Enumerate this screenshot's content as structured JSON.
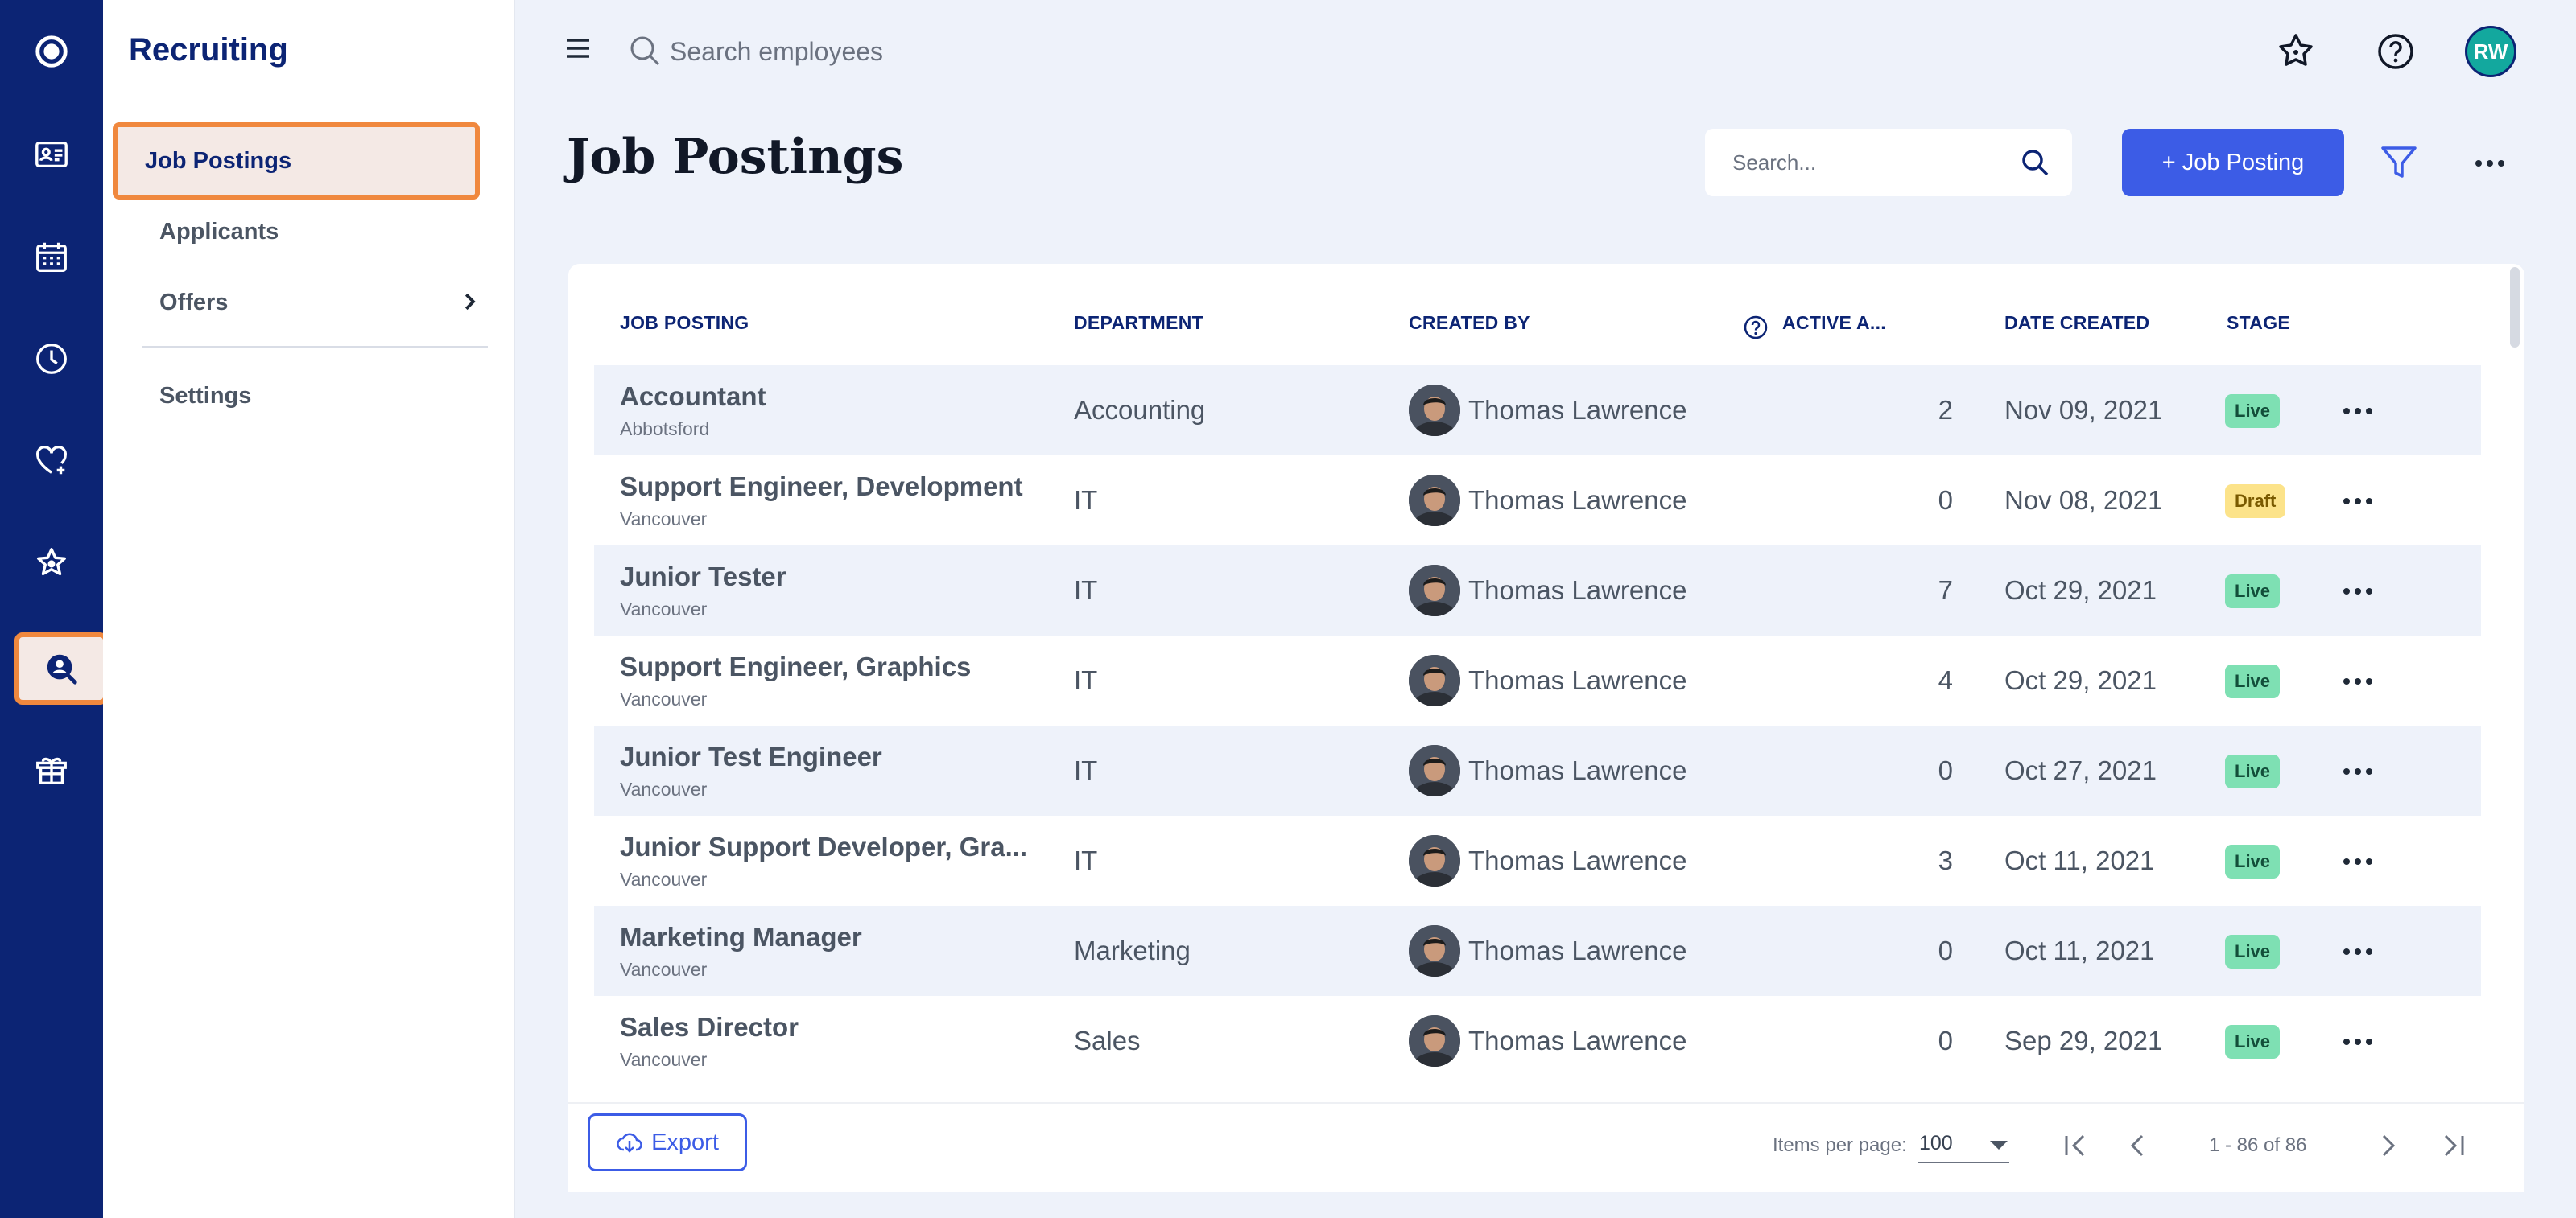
{
  "rail": {
    "items": [
      {
        "icon": "app-logo-icon",
        "active": false
      },
      {
        "icon": "id-card-icon",
        "active": false
      },
      {
        "icon": "calendar-icon",
        "active": false
      },
      {
        "icon": "clock-icon",
        "active": false
      },
      {
        "icon": "heart-plus-icon",
        "active": false
      },
      {
        "icon": "star-icon",
        "active": false
      },
      {
        "icon": "recruiting-search-icon",
        "active": true
      },
      {
        "icon": "gift-box-icon",
        "active": false
      }
    ]
  },
  "subnav": {
    "title": "Recruiting",
    "items": [
      {
        "label": "Job Postings",
        "active": true
      },
      {
        "label": "Applicants",
        "active": false
      },
      {
        "label": "Offers",
        "active": false,
        "has_submenu": true
      },
      {
        "label": "Settings",
        "active": false
      }
    ]
  },
  "topbar": {
    "search_placeholder": "Search employees",
    "avatar_initials": "RW",
    "avatar_color": "#13a89e"
  },
  "page": {
    "title": "Job Postings",
    "search_placeholder": "Search...",
    "add_label": "+ Job Posting",
    "accent_color": "#3c5ce6"
  },
  "table": {
    "columns": [
      "JOB POSTING",
      "DEPARTMENT",
      "CREATED BY",
      "ACTIVE A...",
      "DATE CREATED",
      "STAGE"
    ],
    "rows": [
      {
        "title": "Accountant",
        "location": "Abbotsford",
        "department": "Accounting",
        "created_by": "Thomas Lawrence",
        "active": "2",
        "date": "Nov 09, 2021",
        "stage": "Live"
      },
      {
        "title": "Support Engineer, Development",
        "location": "Vancouver",
        "department": "IT",
        "created_by": "Thomas Lawrence",
        "active": "0",
        "date": "Nov 08, 2021",
        "stage": "Draft"
      },
      {
        "title": "Junior Tester",
        "location": "Vancouver",
        "department": "IT",
        "created_by": "Thomas Lawrence",
        "active": "7",
        "date": "Oct 29, 2021",
        "stage": "Live"
      },
      {
        "title": "Support Engineer, Graphics",
        "location": "Vancouver",
        "department": "IT",
        "created_by": "Thomas Lawrence",
        "active": "4",
        "date": "Oct 29, 2021",
        "stage": "Live"
      },
      {
        "title": "Junior Test Engineer",
        "location": "Vancouver",
        "department": "IT",
        "created_by": "Thomas Lawrence",
        "active": "0",
        "date": "Oct 27, 2021",
        "stage": "Live"
      },
      {
        "title": "Junior Support Developer, Gra...",
        "location": "Vancouver",
        "department": "IT",
        "created_by": "Thomas Lawrence",
        "active": "3",
        "date": "Oct 11, 2021",
        "stage": "Live"
      },
      {
        "title": "Marketing Manager",
        "location": "Vancouver",
        "department": "Marketing",
        "created_by": "Thomas Lawrence",
        "active": "0",
        "date": "Oct 11, 2021",
        "stage": "Live"
      },
      {
        "title": "Sales Director",
        "location": "Vancouver",
        "department": "Sales",
        "created_by": "Thomas Lawrence",
        "active": "0",
        "date": "Sep 29, 2021",
        "stage": "Live"
      }
    ]
  },
  "footer": {
    "export_label": "Export",
    "items_per_page_label": "Items per page:",
    "items_per_page": "100",
    "range": "1 - 86 of 86"
  }
}
